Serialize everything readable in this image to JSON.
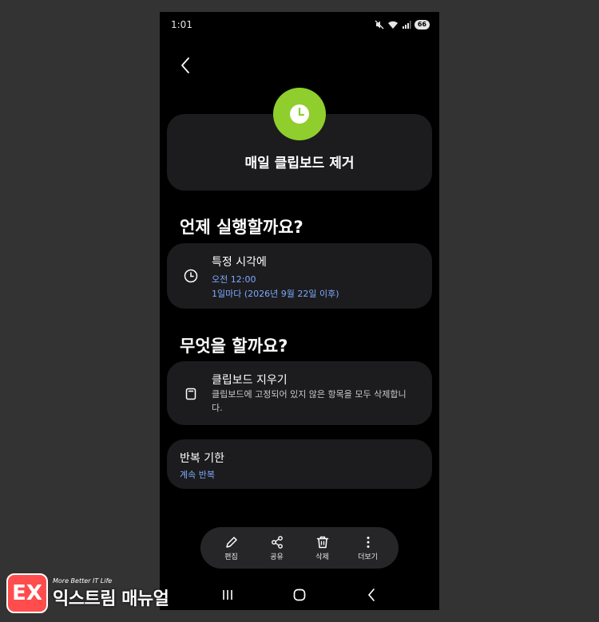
{
  "status_bar": {
    "time": "1:01",
    "battery": "66"
  },
  "routine": {
    "title": "매일 클립보드 제거",
    "icon": "clock-icon",
    "icon_color": "#8fce2d"
  },
  "when": {
    "heading": "언제 실행할까요?",
    "condition_title": "특정 시각에",
    "time_value": "오전 12:00",
    "repeat_value": "1일마다 (2026년 9월 22일 이후)"
  },
  "what": {
    "heading": "무엇을 할까요?",
    "action_title": "클립보드 지우기",
    "action_desc": "클립보드에 고정되어 있지 않은 항목을 모두 삭제합니다."
  },
  "repeat_limit": {
    "title": "반복 기한",
    "value": "계속 반복"
  },
  "toolbar": {
    "edit_label": "편집",
    "share_label": "공유",
    "delete_label": "삭제",
    "more_label": "더보기"
  },
  "watermark": {
    "tagline": "More Better IT Life",
    "name": "익스트림 매뉴얼"
  },
  "colors": {
    "accent_blue": "#7ea9ff",
    "card_bg": "#1c1c1e",
    "screen_bg": "#000000"
  }
}
